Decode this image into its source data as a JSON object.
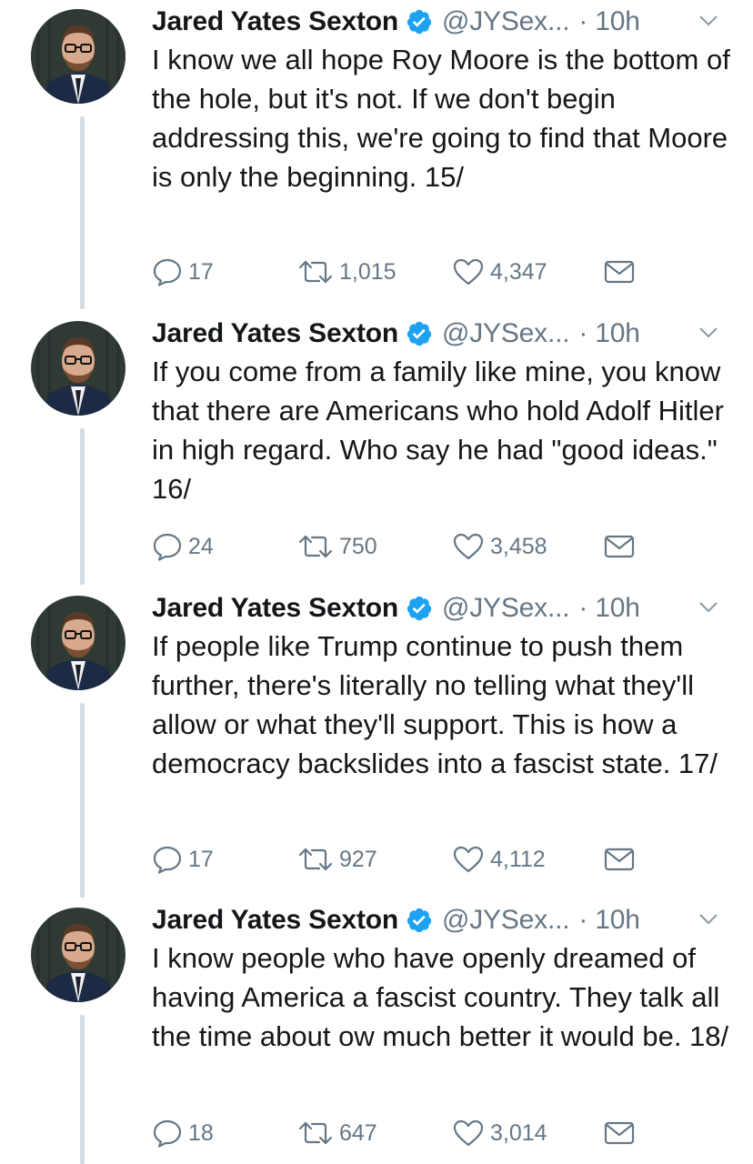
{
  "tweets": [
    {
      "name": "Jared Yates Sexton",
      "handle": "@JYSex...",
      "time": "· 10h",
      "text": "I know we all hope Roy Moore is the bottom of the hole, but it's not. If we don't begin addressing this, we're going to find that Moore is only the beginning. 15/",
      "replies": "17",
      "retweets": "1,015",
      "likes": "4,347"
    },
    {
      "name": "Jared Yates Sexton",
      "handle": "@JYSex...",
      "time": "· 10h",
      "text": "If you come from a family like mine, you know that there are Americans who hold Adolf Hitler in high regard. Who say he had \"good ideas.\" 16/",
      "replies": "24",
      "retweets": "750",
      "likes": "3,458"
    },
    {
      "name": "Jared Yates Sexton",
      "handle": "@JYSex...",
      "time": "· 10h",
      "text": "If people like Trump continue to push them further, there's literally no telling what they'll allow or what they'll support. This is how a democracy backslides into a fascist state. 17/",
      "replies": "17",
      "retweets": "927",
      "likes": "4,112"
    },
    {
      "name": "Jared Yates Sexton",
      "handle": "@JYSex...",
      "time": "· 10h",
      "text": "I know people who have openly dreamed of having America a fascist country. They talk all the time about ow much better it would be. 18/",
      "replies": "18",
      "retweets": "647",
      "likes": "3,014"
    }
  ],
  "icons": {
    "verified": "verified-badge-icon",
    "caret": "chevron-down-icon",
    "reply": "reply-icon",
    "retweet": "retweet-icon",
    "like": "heart-icon",
    "dm": "envelope-icon"
  },
  "colors": {
    "text": "#14171a",
    "secondary": "#657786",
    "verified": "#1da1f2",
    "thread_line": "#d4dbe1"
  }
}
